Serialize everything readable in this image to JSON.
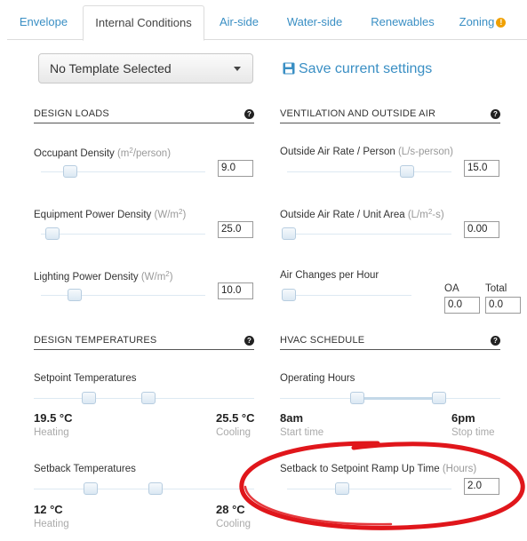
{
  "tabs": [
    {
      "label": "Envelope",
      "active": false
    },
    {
      "label": "Internal Conditions",
      "active": true
    },
    {
      "label": "Air-side",
      "active": false
    },
    {
      "label": "Water-side",
      "active": false
    },
    {
      "label": "Renewables",
      "active": false
    },
    {
      "label": "Zoning",
      "active": false,
      "warning": true
    }
  ],
  "template": {
    "selected": "No Template Selected"
  },
  "save": {
    "label": "Save current settings",
    "icon": "floppy-disk-icon"
  },
  "design_loads": {
    "title": "DESIGN LOADS",
    "occupant": {
      "label": "Occupant Density",
      "unit_pre": "(m",
      "unit_sup": "2",
      "unit_post": "/person)",
      "value": "9.0",
      "slider": 0.18
    },
    "equipment": {
      "label": "Equipment Power Density",
      "unit_pre": "(W/m",
      "unit_sup": "2",
      "unit_post": ")",
      "value": "25.0",
      "slider": 0.02
    },
    "lighting": {
      "label": "Lighting Power Density",
      "unit_pre": "(W/m",
      "unit_sup": "2",
      "unit_post": ")",
      "value": "10.0",
      "slider": 0.2
    }
  },
  "ventilation": {
    "title": "VENTILATION AND OUTSIDE AIR",
    "oa_person": {
      "label": "Outside Air Rate / Person",
      "unit": "(L/s-person)",
      "value": "15.0",
      "slider": 0.7
    },
    "oa_area": {
      "label": "Outside Air Rate / Unit Area",
      "unit_pre": "(L/m",
      "unit_sup": "2",
      "unit_post": "-s)",
      "value": "0.00",
      "slider": 0.0
    },
    "ach": {
      "label": "Air Changes per Hour",
      "oa_label": "OA",
      "oa_value": "0.0",
      "total_label": "Total",
      "total_value": "0.0",
      "slider": 0.0
    }
  },
  "design_temps": {
    "title": "DESIGN TEMPERATURES",
    "setpoint": {
      "label": "Setpoint Temperatures",
      "heat_value": "19.5 °C",
      "heat_label": "Heating",
      "cool_value": "25.5 °C",
      "cool_label": "Cooling"
    },
    "setback": {
      "label": "Setback Temperatures",
      "heat_value": "12 °C",
      "heat_label": "Heating",
      "cool_value": "28 °C",
      "cool_label": "Cooling"
    }
  },
  "hvac_schedule": {
    "title": "HVAC SCHEDULE",
    "operating": {
      "label": "Operating Hours",
      "start_value": "8am",
      "start_label": "Start time",
      "stop_value": "6pm",
      "stop_label": "Stop time"
    },
    "ramp": {
      "label": "Setback to Setpoint Ramp Up Time",
      "unit": "(Hours)",
      "value": "2.0"
    }
  },
  "colors": {
    "link": "#3a8fc4",
    "annotation": "#e0161b",
    "warning": "#f0a000"
  }
}
